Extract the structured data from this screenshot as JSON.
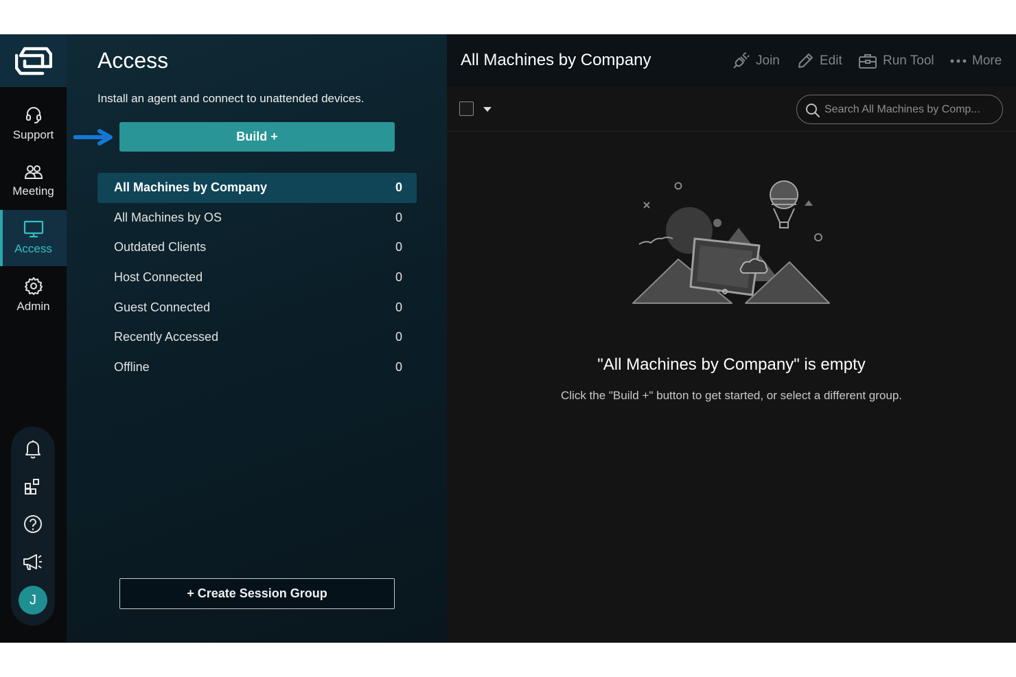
{
  "rail": {
    "items": [
      {
        "label": "Support",
        "icon": "headset-icon"
      },
      {
        "label": "Meeting",
        "icon": "people-icon"
      },
      {
        "label": "Access",
        "icon": "monitor-icon",
        "active": true
      },
      {
        "label": "Admin",
        "icon": "gear-icon"
      }
    ],
    "bottom_icons": [
      "bell-icon",
      "extensions-icon",
      "help-icon",
      "megaphone-icon"
    ],
    "avatar_initial": "J"
  },
  "panel": {
    "title": "Access",
    "description": "Install an agent and connect to unattended devices.",
    "build_label": "Build +",
    "groups": [
      {
        "name": "All Machines by Company",
        "count": "0",
        "active": true
      },
      {
        "name": "All Machines by OS",
        "count": "0"
      },
      {
        "name": "Outdated Clients",
        "count": "0"
      },
      {
        "name": "Host Connected",
        "count": "0"
      },
      {
        "name": "Guest Connected",
        "count": "0"
      },
      {
        "name": "Recently Accessed",
        "count": "0"
      },
      {
        "name": "Offline",
        "count": "0"
      }
    ],
    "create_group_label": "+ Create Session Group"
  },
  "main": {
    "title": "All Machines by Company",
    "tools": {
      "join": "Join",
      "edit": "Edit",
      "run_tool": "Run Tool",
      "more": "More"
    },
    "search_placeholder": "Search All Machines by Comp...",
    "empty_title": "\"All Machines by Company\" is empty",
    "empty_subtitle": "Click the \"Build +\" button to get started, or select a different group."
  },
  "colors": {
    "accent": "#2a9596",
    "active_label": "#35c0c2",
    "pointer_arrow": "#1677d2"
  }
}
